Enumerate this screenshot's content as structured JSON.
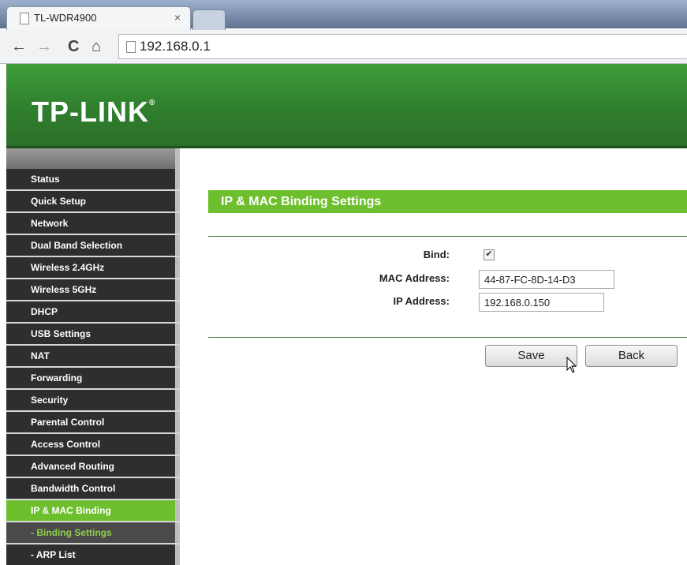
{
  "browser": {
    "tab_title": "TL-WDR4900",
    "tab_close": "×",
    "url": "192.168.0.1",
    "back": "←",
    "forward": "→",
    "reload": "C",
    "home": "⌂"
  },
  "brand": {
    "logo_text": "TP-LINK",
    "logo_mark": "®"
  },
  "sidebar": {
    "items": [
      {
        "label": "Status"
      },
      {
        "label": "Quick Setup"
      },
      {
        "label": "Network"
      },
      {
        "label": "Dual Band Selection"
      },
      {
        "label": "Wireless 2.4GHz"
      },
      {
        "label": "Wireless 5GHz"
      },
      {
        "label": "DHCP"
      },
      {
        "label": "USB Settings"
      },
      {
        "label": "NAT"
      },
      {
        "label": "Forwarding"
      },
      {
        "label": "Security"
      },
      {
        "label": "Parental Control"
      },
      {
        "label": "Access Control"
      },
      {
        "label": "Advanced Routing"
      },
      {
        "label": "Bandwidth Control"
      },
      {
        "label": "IP & MAC Binding"
      },
      {
        "label": "- Binding Settings"
      },
      {
        "label": "- ARP List"
      }
    ]
  },
  "main": {
    "title": "IP & MAC Binding Settings",
    "bind_label": "Bind:",
    "bind_checked": "✔",
    "mac_label": "MAC Address:",
    "mac_value": "44-87-FC-8D-14-D3",
    "ip_label": "IP Address:",
    "ip_value": "192.168.0.150",
    "save_label": "Save",
    "back_label": "Back"
  },
  "colors": {
    "accent": "#6ebf2e",
    "header": "#2f7f2d"
  }
}
